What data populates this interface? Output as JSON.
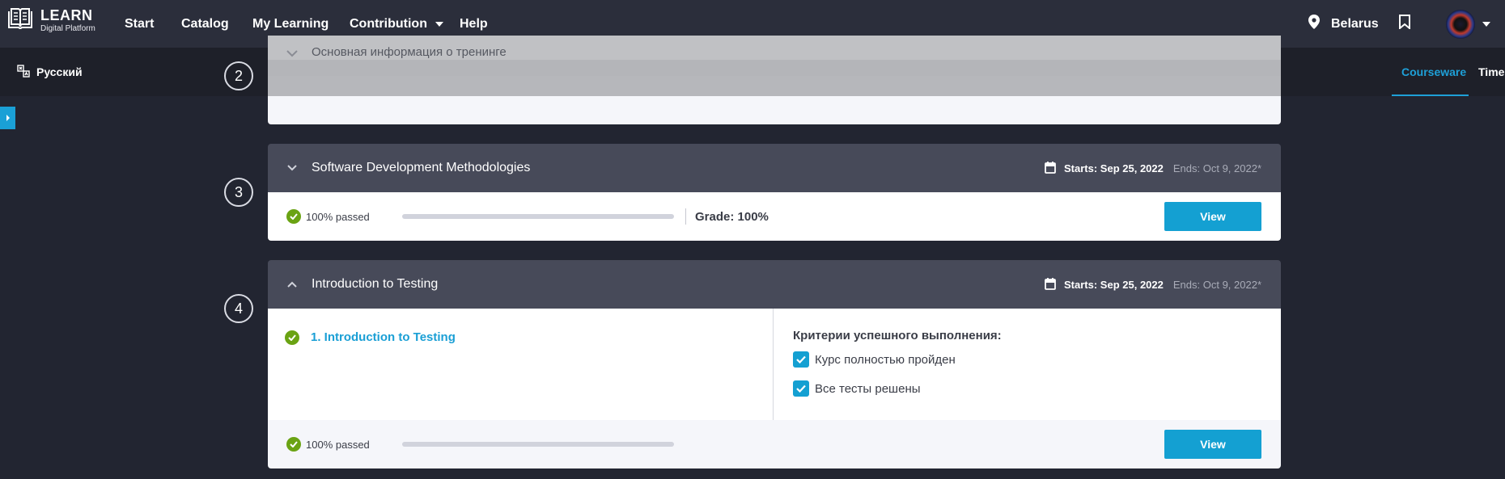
{
  "brand": {
    "title": "LEARN",
    "subtitle": "Digital Platform"
  },
  "nav": {
    "items": [
      "Start",
      "Catalog",
      "My Learning",
      "Contribution",
      "Help"
    ],
    "location": "Belarus"
  },
  "subbar": {
    "language": "Русский",
    "tabs": [
      "Courseware",
      "Timel"
    ]
  },
  "sections": [
    {
      "step": "2",
      "title": "Основная информация о тренинге"
    },
    {
      "step": "3",
      "title": "Software Development Methodologies",
      "starts": "Starts: Sep 25, 2022",
      "ends": "Ends: Oct 9, 2022*",
      "passed": "100% passed",
      "progress": 0,
      "grade": "Grade: 100%",
      "view_label": "View"
    },
    {
      "step": "4",
      "title": "Introduction to Testing",
      "starts": "Starts: Sep 25, 2022",
      "ends": "Ends: Oct 9, 2022*",
      "lesson": "1. Introduction to Testing",
      "criteria_title": "Критерии успешного выполнения:",
      "criteria": [
        "Курс полностью пройден",
        "Все тесты решены"
      ],
      "passed": "100% passed",
      "progress": 0,
      "view_label": "View"
    }
  ],
  "colors": {
    "accent": "#14a0d2",
    "success": "#6aa313",
    "nav_bg": "#2b2e3b",
    "page_bg": "#222531"
  }
}
